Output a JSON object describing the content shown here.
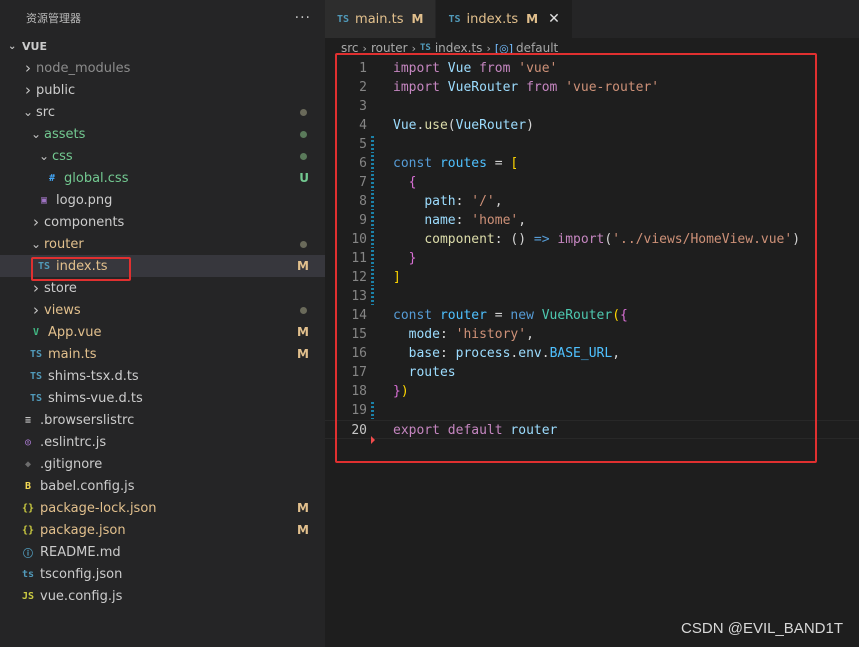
{
  "explorer": {
    "title": "资源管理器",
    "more": "···",
    "section": "VUE",
    "items": [
      {
        "label": "node_modules",
        "kind": "folder",
        "expanded": false,
        "depth": 0,
        "color": "#8c8c8c"
      },
      {
        "label": "public",
        "kind": "folder",
        "expanded": false,
        "depth": 0,
        "color": "#cccccc"
      },
      {
        "label": "src",
        "kind": "folder",
        "expanded": true,
        "depth": 0,
        "color": "#cccccc",
        "dot": "#6a6a5a"
      },
      {
        "label": "assets",
        "kind": "folder",
        "expanded": true,
        "depth": 1,
        "color": "#73c991",
        "dot": "#5a7a5a"
      },
      {
        "label": "css",
        "kind": "folder",
        "expanded": true,
        "depth": 2,
        "color": "#73c991",
        "dot": "#5a7a5a"
      },
      {
        "label": "global.css",
        "kind": "file",
        "icon": "#",
        "iconColor": "#42a5f5",
        "depth": 3,
        "color": "#73c991",
        "badge": "U",
        "badgeColor": "#73c991"
      },
      {
        "label": "logo.png",
        "kind": "file",
        "icon": "▣",
        "iconColor": "#a074c4",
        "depth": 2,
        "color": "#cccccc"
      },
      {
        "label": "components",
        "kind": "folder",
        "expanded": false,
        "depth": 1,
        "color": "#cccccc"
      },
      {
        "label": "router",
        "kind": "folder",
        "expanded": true,
        "depth": 1,
        "color": "#e2c08d",
        "dot": "#6a6a5a"
      },
      {
        "label": "index.ts",
        "kind": "file",
        "icon": "TS",
        "iconColor": "#519aba",
        "depth": 2,
        "color": "#e2c08d",
        "badge": "M",
        "badgeColor": "#e2c08d",
        "selected": true
      },
      {
        "label": "store",
        "kind": "folder",
        "expanded": false,
        "depth": 1,
        "color": "#cccccc"
      },
      {
        "label": "views",
        "kind": "folder",
        "expanded": false,
        "depth": 1,
        "color": "#e2c08d",
        "dot": "#6a6a5a"
      },
      {
        "label": "App.vue",
        "kind": "file",
        "icon": "V",
        "iconColor": "#41b883",
        "depth": 1,
        "color": "#e2c08d",
        "badge": "M",
        "badgeColor": "#e2c08d"
      },
      {
        "label": "main.ts",
        "kind": "file",
        "icon": "TS",
        "iconColor": "#519aba",
        "depth": 1,
        "color": "#e2c08d",
        "badge": "M",
        "badgeColor": "#e2c08d"
      },
      {
        "label": "shims-tsx.d.ts",
        "kind": "file",
        "icon": "TS",
        "iconColor": "#519aba",
        "depth": 1,
        "color": "#cccccc"
      },
      {
        "label": "shims-vue.d.ts",
        "kind": "file",
        "icon": "TS",
        "iconColor": "#519aba",
        "depth": 1,
        "color": "#cccccc"
      },
      {
        "label": ".browserslistrc",
        "kind": "file",
        "icon": "≡",
        "iconColor": "#c5c5c5",
        "depth": 0,
        "color": "#cccccc"
      },
      {
        "label": ".eslintrc.js",
        "kind": "file",
        "icon": "◎",
        "iconColor": "#a074c4",
        "depth": 0,
        "color": "#cccccc"
      },
      {
        "label": ".gitignore",
        "kind": "file",
        "icon": "◆",
        "iconColor": "#6d6d6d",
        "depth": 0,
        "color": "#cccccc"
      },
      {
        "label": "babel.config.js",
        "kind": "file",
        "icon": "B",
        "iconColor": "#f5da55",
        "depth": 0,
        "color": "#cccccc"
      },
      {
        "label": "package-lock.json",
        "kind": "file",
        "icon": "{}",
        "iconColor": "#cbcb41",
        "depth": 0,
        "color": "#e2c08d",
        "badge": "M",
        "badgeColor": "#e2c08d"
      },
      {
        "label": "package.json",
        "kind": "file",
        "icon": "{}",
        "iconColor": "#cbcb41",
        "depth": 0,
        "color": "#e2c08d",
        "badge": "M",
        "badgeColor": "#e2c08d"
      },
      {
        "label": "README.md",
        "kind": "file",
        "icon": "ⓘ",
        "iconColor": "#519aba",
        "depth": 0,
        "color": "#cccccc"
      },
      {
        "label": "tsconfig.json",
        "kind": "file",
        "icon": "ts",
        "iconColor": "#519aba",
        "depth": 0,
        "color": "#cccccc"
      },
      {
        "label": "vue.config.js",
        "kind": "file",
        "icon": "JS",
        "iconColor": "#cbcb41",
        "depth": 0,
        "color": "#cccccc"
      }
    ]
  },
  "tabs": [
    {
      "icon": "TS",
      "label": "main.ts",
      "status": "M",
      "active": false
    },
    {
      "icon": "TS",
      "label": "index.ts",
      "status": "M",
      "active": true,
      "close": "✕"
    }
  ],
  "breadcrumb": {
    "parts": [
      "src",
      "router"
    ],
    "file_icon": "TS",
    "file": "index.ts",
    "symbol_icon": "[◎]",
    "symbol": "default",
    "sep": "›"
  },
  "code": {
    "current_line": 20,
    "lines": [
      [
        [
          "k",
          "import"
        ],
        [
          "t",
          " "
        ],
        [
          "v",
          "Vue"
        ],
        [
          "t",
          " "
        ],
        [
          "k",
          "from"
        ],
        [
          "t",
          " "
        ],
        [
          "s",
          "'vue'"
        ]
      ],
      [
        [
          "k",
          "import"
        ],
        [
          "t",
          " "
        ],
        [
          "v",
          "VueRouter"
        ],
        [
          "t",
          " "
        ],
        [
          "k",
          "from"
        ],
        [
          "t",
          " "
        ],
        [
          "s",
          "'vue-router'"
        ]
      ],
      [],
      [
        [
          "v",
          "Vue"
        ],
        [
          "t",
          "."
        ],
        [
          "f",
          "use"
        ],
        [
          "t",
          "("
        ],
        [
          "v",
          "VueRouter"
        ],
        [
          "t",
          ")"
        ]
      ],
      [],
      [
        [
          "b",
          "const"
        ],
        [
          "t",
          " "
        ],
        [
          "n",
          "routes"
        ],
        [
          "t",
          " = "
        ],
        [
          "y",
          "["
        ]
      ],
      [
        [
          "t",
          "  "
        ],
        [
          "p",
          "{"
        ]
      ],
      [
        [
          "t",
          "    "
        ],
        [
          "v",
          "path"
        ],
        [
          "t",
          ": "
        ],
        [
          "s",
          "'/'"
        ],
        [
          "t",
          ","
        ]
      ],
      [
        [
          "t",
          "    "
        ],
        [
          "v",
          "name"
        ],
        [
          "t",
          ": "
        ],
        [
          "s",
          "'home'"
        ],
        [
          "t",
          ","
        ]
      ],
      [
        [
          "t",
          "    "
        ],
        [
          "f",
          "component"
        ],
        [
          "t",
          ": () "
        ],
        [
          "b",
          "=>"
        ],
        [
          "t",
          " "
        ],
        [
          "k",
          "import"
        ],
        [
          "t",
          "("
        ],
        [
          "s",
          "'../views/HomeView.vue'"
        ],
        [
          "t",
          ")"
        ]
      ],
      [
        [
          "t",
          "  "
        ],
        [
          "p",
          "}"
        ]
      ],
      [
        [
          "y",
          "]"
        ]
      ],
      [],
      [
        [
          "b",
          "const"
        ],
        [
          "t",
          " "
        ],
        [
          "n",
          "router"
        ],
        [
          "t",
          " = "
        ],
        [
          "b",
          "new"
        ],
        [
          "t",
          " "
        ],
        [
          "c",
          "VueRouter"
        ],
        [
          "y",
          "("
        ],
        [
          "p",
          "{"
        ]
      ],
      [
        [
          "t",
          "  "
        ],
        [
          "v",
          "mode"
        ],
        [
          "t",
          ": "
        ],
        [
          "s",
          "'history'"
        ],
        [
          "t",
          ","
        ]
      ],
      [
        [
          "t",
          "  "
        ],
        [
          "v",
          "base"
        ],
        [
          "t",
          ": "
        ],
        [
          "v",
          "process"
        ],
        [
          "t",
          "."
        ],
        [
          "v",
          "env"
        ],
        [
          "t",
          "."
        ],
        [
          "n",
          "BASE_URL"
        ],
        [
          "t",
          ","
        ]
      ],
      [
        [
          "t",
          "  "
        ],
        [
          "v",
          "routes"
        ]
      ],
      [
        [
          "p",
          "}"
        ],
        [
          "y",
          ")"
        ]
      ],
      [],
      [
        [
          "k",
          "export"
        ],
        [
          "t",
          " "
        ],
        [
          "k",
          "default"
        ],
        [
          "t",
          " "
        ],
        [
          "v",
          "router"
        ]
      ]
    ],
    "gutter": [
      "",
      "",
      "",
      "",
      "mod",
      "mod",
      "mod",
      "mod",
      "mod",
      "mod",
      "mod",
      "mod",
      "mod",
      "",
      "",
      "",
      "",
      "",
      "mod",
      "del"
    ]
  },
  "watermark": "CSDN @EVIL_BAND1T"
}
